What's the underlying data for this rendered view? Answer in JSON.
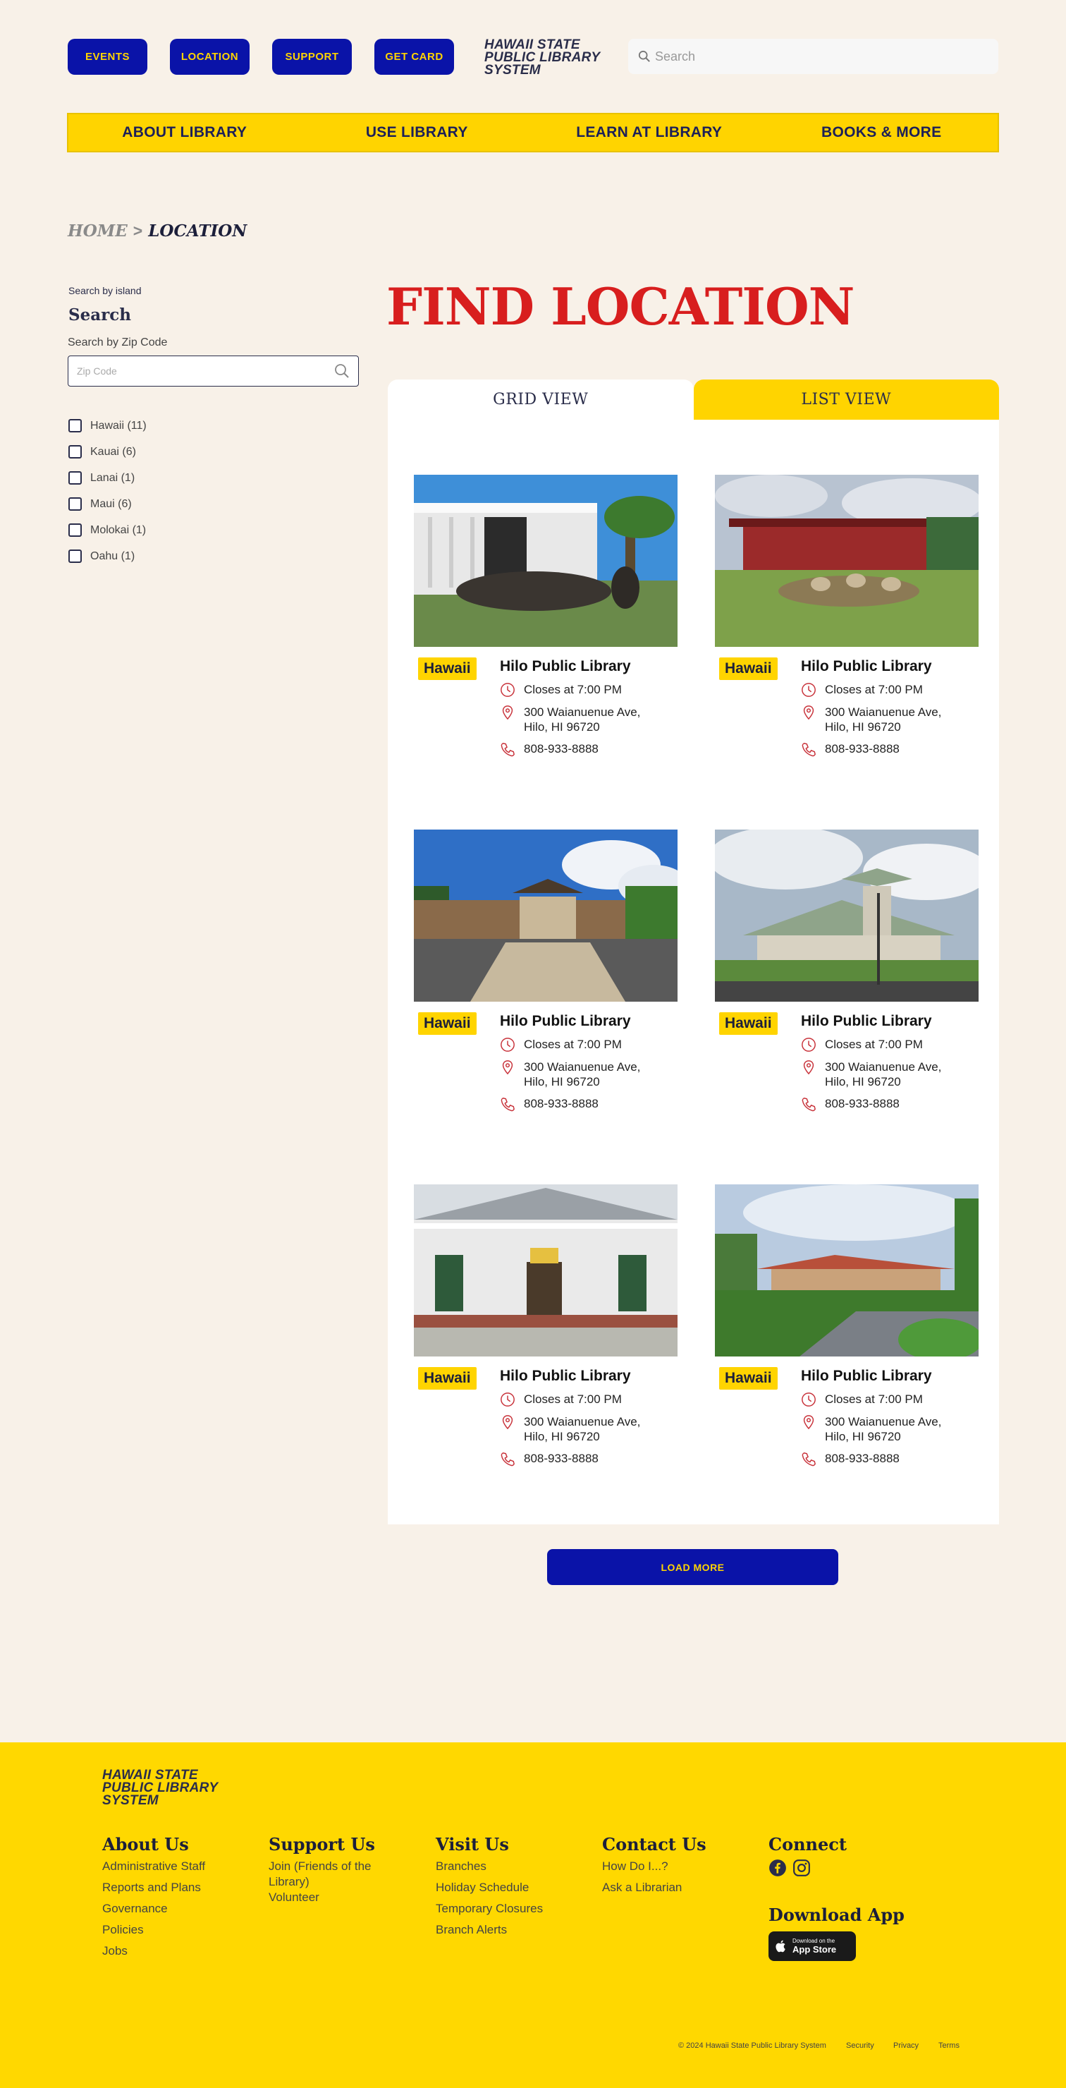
{
  "header": {
    "buttons": [
      "EVENTS",
      "LOCATION",
      "SUPPORT",
      "GET CARD"
    ],
    "logo": [
      "HAWAII STATE",
      "PUBLIC LIBRARY",
      "SYSTEM"
    ],
    "search_placeholder": "Search"
  },
  "nav": [
    "ABOUT LIBRARY",
    "USE LIBRARY",
    "LEARN AT LIBRARY",
    "BOOKS & MORE"
  ],
  "breadcrumb": {
    "home": "HOME",
    "sep": ">",
    "current": "LOCATION"
  },
  "sidebar": {
    "small_label": "Search by island",
    "title": "Search",
    "zip_label": "Search by Zip Code",
    "zip_placeholder": "Zip Code",
    "islands": [
      "Hawaii (11)",
      "Kauai (6)",
      "Lanai (1)",
      "Maui (6)",
      "Molokai (1)",
      "Oahu (1)"
    ]
  },
  "main": {
    "title": "FIND LOCATION",
    "tabs": [
      "GRID VIEW",
      "LIST VIEW"
    ],
    "cards": [
      {
        "island": "Hawaii",
        "name": "Hilo Public Library",
        "hours": "Closes at 7:00 PM",
        "address": "300 Waianuenue Ave, Hilo, HI 96720",
        "phone": "808-933-8888"
      },
      {
        "island": "Hawaii",
        "name": "Hilo Public Library",
        "hours": "Closes at 7:00 PM",
        "address": "300 Waianuenue Ave, Hilo, HI 96720",
        "phone": "808-933-8888"
      },
      {
        "island": "Hawaii",
        "name": "Hilo Public Library",
        "hours": "Closes at 7:00 PM",
        "address": "300 Waianuenue Ave, Hilo, HI 96720",
        "phone": "808-933-8888"
      },
      {
        "island": "Hawaii",
        "name": "Hilo Public Library",
        "hours": "Closes at 7:00 PM",
        "address": "300 Waianuenue Ave, Hilo, HI 96720",
        "phone": "808-933-8888"
      },
      {
        "island": "Hawaii",
        "name": "Hilo Public Library",
        "hours": "Closes at 7:00 PM",
        "address": "300 Waianuenue Ave, Hilo, HI 96720",
        "phone": "808-933-8888"
      },
      {
        "island": "Hawaii",
        "name": "Hilo Public Library",
        "hours": "Closes at 7:00 PM",
        "address": "300 Waianuenue Ave, Hilo, HI 96720",
        "phone": "808-933-8888"
      }
    ],
    "load_more": "LOAD MORE"
  },
  "footer": {
    "logo": [
      "HAWAII STATE",
      "PUBLIC LIBRARY",
      "SYSTEM"
    ],
    "about": {
      "title": "About Us",
      "links": [
        "Administrative Staff",
        "Reports and Plans",
        "Governance",
        "Policies",
        "Jobs"
      ]
    },
    "support": {
      "title": "Support Us",
      "links": [
        "Join (Friends of the Library)",
        "Volunteer"
      ]
    },
    "visit": {
      "title": "Visit Us",
      "links": [
        "Branches",
        "Holiday Schedule",
        "Temporary Closures",
        "Branch Alerts"
      ]
    },
    "contact": {
      "title": "Contact Us",
      "links": [
        "How Do I...?",
        "Ask a Librarian"
      ]
    },
    "connect": {
      "title": "Connect",
      "icons": [
        "facebook-icon",
        "instagram-icon"
      ]
    },
    "download": {
      "title": "Download App",
      "store_small": "Download on the",
      "store_big": "App Store"
    },
    "copyright": "© 2024 Hawaii State Public Library System",
    "bottom_links": [
      "Security",
      "Privacy",
      "Terms"
    ]
  },
  "colors": {
    "brand_blue": "#0a13a8",
    "brand_yellow": "#ffd400",
    "title_red": "#d81e1e",
    "background": "#f8f1e8"
  }
}
